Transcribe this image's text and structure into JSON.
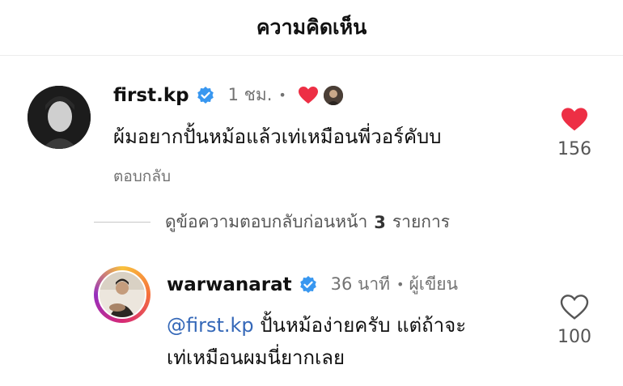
{
  "header": {
    "title": "ความคิดเห็น"
  },
  "comment1": {
    "username": "first.kp",
    "time": "1 ชม.",
    "text": "ผ้มอยากปั้นหม้อแล้วเท่เหมือนพี่วอร์คับบ",
    "reply_label": "ตอบกลับ",
    "like_count": "156",
    "liked": true,
    "like_color": "#ed2f45"
  },
  "view_replies": {
    "label_prefix": "ดูข้อความตอบกลับก่อนหน้า",
    "count": "3",
    "label_suffix": "รายการ"
  },
  "comment2": {
    "username": "warwanarat",
    "time": "36 นาที",
    "author_tag": "ผู้เขียน",
    "mention": "@first.kp",
    "text_line1": "ปั้นหม้อง่ายครับ แต่ถ้าจะ",
    "text_line2": "เท่เหมือนผมนี่ยากเลย",
    "like_count": "100",
    "liked": false
  },
  "colors": {
    "verified": "#3897f0",
    "mention": "#3568b8",
    "like": "#ed2f45"
  }
}
